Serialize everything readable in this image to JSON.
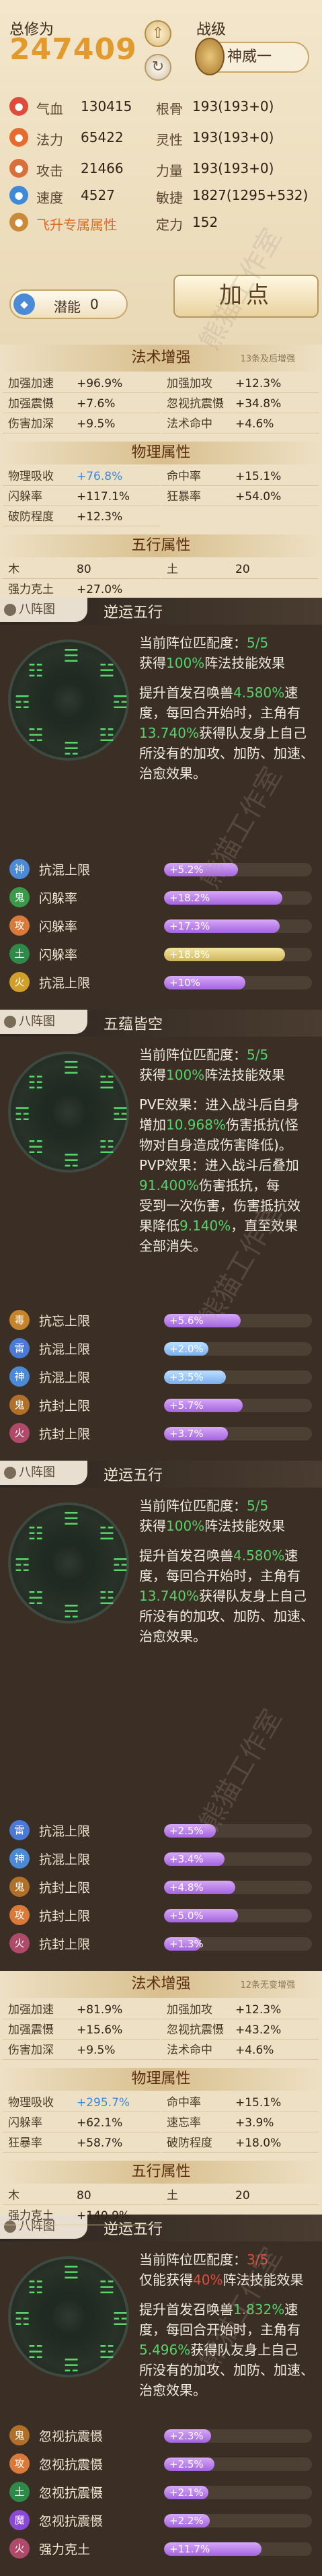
{
  "header": {
    "power_label": "总修为",
    "power_value": "247409",
    "rank_label": "战级",
    "rank_value": "神威一",
    "attrs": [
      {
        "icon": "heart-icon",
        "color": "#e04a3a",
        "k1": "气血",
        "v1": "130415",
        "k2": "根骨",
        "v2": "193(193+0)"
      },
      {
        "icon": "flame-icon",
        "color": "#e66b2c",
        "k1": "法力",
        "v1": "65422",
        "k2": "灵性",
        "v2": "193(193+0)"
      },
      {
        "icon": "sword-icon",
        "color": "#d96f3a",
        "k1": "攻击",
        "v1": "21466",
        "k2": "力量",
        "v2": "193(193+0)"
      },
      {
        "icon": "wing-icon",
        "color": "#3c8ad9",
        "k1": "速度",
        "v1": "4527",
        "k2": "敏捷",
        "v2": "1827(1295+532)"
      },
      {
        "icon": "flag-icon",
        "color": "#c98a3a",
        "k1": "飞升专属属性",
        "v1": "",
        "k2": "定力",
        "v2": "152"
      }
    ],
    "potential_label": "潜能",
    "potential_value": "0",
    "add_label": "加点"
  },
  "table1": {
    "title": "法术增强",
    "note": "13条及后增强",
    "rows": [
      [
        "加强加速",
        "+96.9%",
        "加强加攻",
        "+12.3%"
      ],
      [
        "加强震慑",
        "+7.6%",
        "忽视抗震慑",
        "+34.8%"
      ],
      [
        "伤害加深",
        "+9.5%",
        "法术命中",
        "+4.6%"
      ]
    ],
    "sec2": "物理属性",
    "rows2": [
      [
        "物理吸收",
        "+76.8%",
        "命中率",
        "+15.1%"
      ],
      [
        "闪躲率",
        "+117.1%",
        "狂暴率",
        "+54.0%"
      ]
    ],
    "single2": [
      "破防程度",
      "+12.3%"
    ],
    "sec3": "五行属性",
    "five": [
      [
        "木",
        "80"
      ],
      [
        "土",
        "20"
      ]
    ],
    "single3": [
      "强力克土",
      "+27.0%"
    ]
  },
  "panels": [
    {
      "badge": "八阵图",
      "title": "逆运五行",
      "text": [
        {
          "parts": [
            [
              "当前阵位匹配度：",
              "n"
            ],
            [
              "5/5",
              "g"
            ]
          ]
        },
        {
          "parts": [
            [
              "获得",
              "n"
            ],
            [
              "100%",
              "g"
            ],
            [
              "阵法技能效果",
              "n"
            ]
          ]
        },
        {
          "parts": [
            [
              "",
              "n"
            ]
          ]
        },
        {
          "parts": [
            [
              "提升首发召唤兽",
              "n"
            ],
            [
              "4.580%",
              "g"
            ],
            [
              "速",
              "n"
            ]
          ]
        },
        {
          "parts": [
            [
              "度，每回合开始时，主角有",
              "n"
            ]
          ]
        },
        {
          "parts": [
            [
              "13.740%",
              "g"
            ],
            [
              "获得队友身上自己",
              "n"
            ]
          ]
        },
        {
          "parts": [
            [
              "所没有的加攻、加防、加速、",
              "n"
            ]
          ]
        },
        {
          "parts": [
            [
              "治愈效果。",
              "n"
            ]
          ]
        }
      ],
      "wheel": [
        "鬼",
        "土",
        "木",
        "水",
        "火",
        "金",
        "风",
        "神"
      ],
      "rows": [
        {
          "icon": "神",
          "ic": "#4a8ad6",
          "name": "抗混上限",
          "val": "+5.2%",
          "pct": 0.5,
          "c": ""
        },
        {
          "icon": "鬼",
          "ic": "#3a9a4a",
          "name": "闪躲率",
          "val": "+18.2%",
          "pct": 0.8,
          "c": ""
        },
        {
          "icon": "攻",
          "ic": "#d9793a",
          "name": "闪躲率",
          "val": "+17.3%",
          "pct": 0.78,
          "c": ""
        },
        {
          "icon": "土",
          "ic": "#2f8a4a",
          "name": "闪躲率",
          "val": "+18.8%",
          "pct": 0.82,
          "c": "y"
        },
        {
          "icon": "火",
          "ic": "#d0a02a",
          "name": "抗混上限",
          "val": "+10%",
          "pct": 0.55,
          "c": ""
        }
      ]
    },
    {
      "badge": "八阵图",
      "title": "五蕴皆空",
      "text": [
        {
          "parts": [
            [
              "当前阵位匹配度：",
              "n"
            ],
            [
              "5/5",
              "g"
            ]
          ]
        },
        {
          "parts": [
            [
              "获得",
              "n"
            ],
            [
              "100%",
              "g"
            ],
            [
              "阵法技能效果",
              "n"
            ]
          ]
        },
        {
          "parts": [
            [
              "",
              "n"
            ]
          ]
        },
        {
          "parts": [
            [
              "PVE效果：进入战斗后自身",
              "n"
            ]
          ]
        },
        {
          "parts": [
            [
              "增加",
              "n"
            ],
            [
              "10.968%",
              "g"
            ],
            [
              "伤害抵抗(怪",
              "n"
            ]
          ]
        },
        {
          "parts": [
            [
              "物对自身造成伤害降低)。",
              "n"
            ]
          ]
        },
        {
          "parts": [
            [
              "PVP效果：进入战斗后叠加",
              "n"
            ]
          ]
        },
        {
          "parts": [
            [
              "91.400%",
              "g"
            ],
            [
              "伤害抵抗，每",
              "n"
            ]
          ]
        },
        {
          "parts": [
            [
              "受到一次伤害，伤害抵抗效",
              "n"
            ]
          ]
        },
        {
          "parts": [
            [
              "果降低",
              "n"
            ],
            [
              "9.140%",
              "g"
            ],
            [
              "，直至效果",
              "n"
            ]
          ]
        },
        {
          "parts": [
            [
              "全部消失。",
              "n"
            ]
          ]
        }
      ],
      "wheel": [
        "鬼",
        "土",
        "木",
        "水",
        "火",
        "金",
        "风",
        "神"
      ],
      "rows": [
        {
          "icon": "毒",
          "ic": "#c5842a",
          "name": "抗忘上限",
          "val": "+5.6%",
          "pct": 0.52,
          "c": ""
        },
        {
          "icon": "雷",
          "ic": "#4a7ad6",
          "name": "抗混上限",
          "val": "+2.0%",
          "pct": 0.3,
          "c": "b"
        },
        {
          "icon": "神",
          "ic": "#4a8ad6",
          "name": "抗混上限",
          "val": "+3.5%",
          "pct": 0.42,
          "c": "b"
        },
        {
          "icon": "鬼",
          "ic": "#b0702a",
          "name": "抗封上限",
          "val": "+5.7%",
          "pct": 0.53,
          "c": ""
        },
        {
          "icon": "火",
          "ic": "#b04a6a",
          "name": "抗封上限",
          "val": "+3.7%",
          "pct": 0.43,
          "c": ""
        }
      ]
    },
    {
      "badge": "八阵图",
      "title": "逆运五行",
      "text": [
        {
          "parts": [
            [
              "当前阵位匹配度：",
              "n"
            ],
            [
              "5/5",
              "g"
            ]
          ]
        },
        {
          "parts": [
            [
              "获得",
              "n"
            ],
            [
              "100%",
              "g"
            ],
            [
              "阵法技能效果",
              "n"
            ]
          ]
        },
        {
          "parts": [
            [
              "",
              "n"
            ]
          ]
        },
        {
          "parts": [
            [
              "提升首发召唤兽",
              "n"
            ],
            [
              "4.580%",
              "g"
            ],
            [
              "速",
              "n"
            ]
          ]
        },
        {
          "parts": [
            [
              "度，每回合开始时，主角有",
              "n"
            ]
          ]
        },
        {
          "parts": [
            [
              "13.740%",
              "g"
            ],
            [
              "获得队友身上自己",
              "n"
            ]
          ]
        },
        {
          "parts": [
            [
              "所没有的加攻、加防、加速、",
              "n"
            ]
          ]
        },
        {
          "parts": [
            [
              "治愈效果。",
              "n"
            ]
          ]
        }
      ],
      "wheel": [
        "鬼",
        "土",
        "木",
        "水",
        "火",
        "金",
        "风",
        "神"
      ],
      "rows": [
        {
          "icon": "雷",
          "ic": "#4a7ad6",
          "name": "抗混上限",
          "val": "+2.5%",
          "pct": 0.35,
          "c": ""
        },
        {
          "icon": "神",
          "ic": "#4a8ad6",
          "name": "抗混上限",
          "val": "+3.4%",
          "pct": 0.41,
          "c": ""
        },
        {
          "icon": "鬼",
          "ic": "#b0702a",
          "name": "抗封上限",
          "val": "+4.8%",
          "pct": 0.48,
          "c": ""
        },
        {
          "icon": "攻",
          "ic": "#d9793a",
          "name": "抗封上限",
          "val": "+5.0%",
          "pct": 0.5,
          "c": ""
        },
        {
          "icon": "火",
          "ic": "#b04a6a",
          "name": "抗封上限",
          "val": "+1.3%",
          "pct": 0.25,
          "c": ""
        }
      ]
    },
    {
      "badge": "八阵图",
      "title": "逆运五行",
      "text": [
        {
          "parts": [
            [
              "当前阵位匹配度：",
              "n"
            ],
            [
              "3/5",
              "r"
            ]
          ]
        },
        {
          "parts": [
            [
              "仅能获得",
              "n"
            ],
            [
              "40%",
              "r"
            ],
            [
              "阵法技能效果",
              "n"
            ]
          ]
        },
        {
          "parts": [
            [
              "",
              "n"
            ]
          ]
        },
        {
          "parts": [
            [
              "提升首发召唤兽",
              "n"
            ],
            [
              "1.832%",
              "g"
            ],
            [
              "速",
              "n"
            ]
          ]
        },
        {
          "parts": [
            [
              "度，每回合开始时，主角有",
              "n"
            ]
          ]
        },
        {
          "parts": [
            [
              "5.496%",
              "g"
            ],
            [
              "获得队友身上自己",
              "n"
            ]
          ]
        },
        {
          "parts": [
            [
              "所没有的加攻、加防、加速、",
              "n"
            ]
          ]
        },
        {
          "parts": [
            [
              "治愈效果。",
              "n"
            ]
          ]
        }
      ],
      "wheel": [
        "鬼",
        "土",
        "木",
        "水",
        "火",
        "金",
        "风",
        "神"
      ],
      "rows": [
        {
          "icon": "鬼",
          "ic": "#b0702a",
          "name": "忽视抗震慑",
          "val": "+2.3%",
          "pct": 0.32,
          "c": ""
        },
        {
          "icon": "攻",
          "ic": "#d9793a",
          "name": "忽视抗震慑",
          "val": "+2.5%",
          "pct": 0.34,
          "c": ""
        },
        {
          "icon": "土",
          "ic": "#2f8a4a",
          "name": "忽视抗震慑",
          "val": "+2.1%",
          "pct": 0.3,
          "c": ""
        },
        {
          "icon": "魔",
          "ic": "#8a4ad6",
          "name": "忽视抗震慑",
          "val": "+2.2%",
          "pct": 0.31,
          "c": ""
        },
        {
          "icon": "火",
          "ic": "#b04a6a",
          "name": "强力克土",
          "val": "+11.7%",
          "pct": 0.66,
          "c": ""
        }
      ]
    }
  ],
  "table2": {
    "title": "法术增强",
    "note": "12条无变增强",
    "rows": [
      [
        "加强加速",
        "+81.9%",
        "加强加攻",
        "+12.3%"
      ],
      [
        "加强震慑",
        "+15.6%",
        "忽视抗震慑",
        "+43.2%"
      ],
      [
        "伤害加深",
        "+9.5%",
        "法术命中",
        "+4.6%"
      ]
    ],
    "sec2": "物理属性",
    "rows2": [
      [
        "物理吸收",
        "+295.7%",
        "命中率",
        "+15.1%"
      ],
      [
        "闪躲率",
        "+62.1%",
        "速忘率",
        "+3.9%"
      ],
      [
        "狂暴率",
        "+58.7%",
        "破防程度",
        "+18.0%"
      ]
    ],
    "sec3": "五行属性",
    "five": [
      [
        "木",
        "80"
      ],
      [
        "土",
        "20"
      ]
    ],
    "single3": [
      "强力克土",
      "+140.9%"
    ]
  },
  "watermark": "熊猫工作室"
}
